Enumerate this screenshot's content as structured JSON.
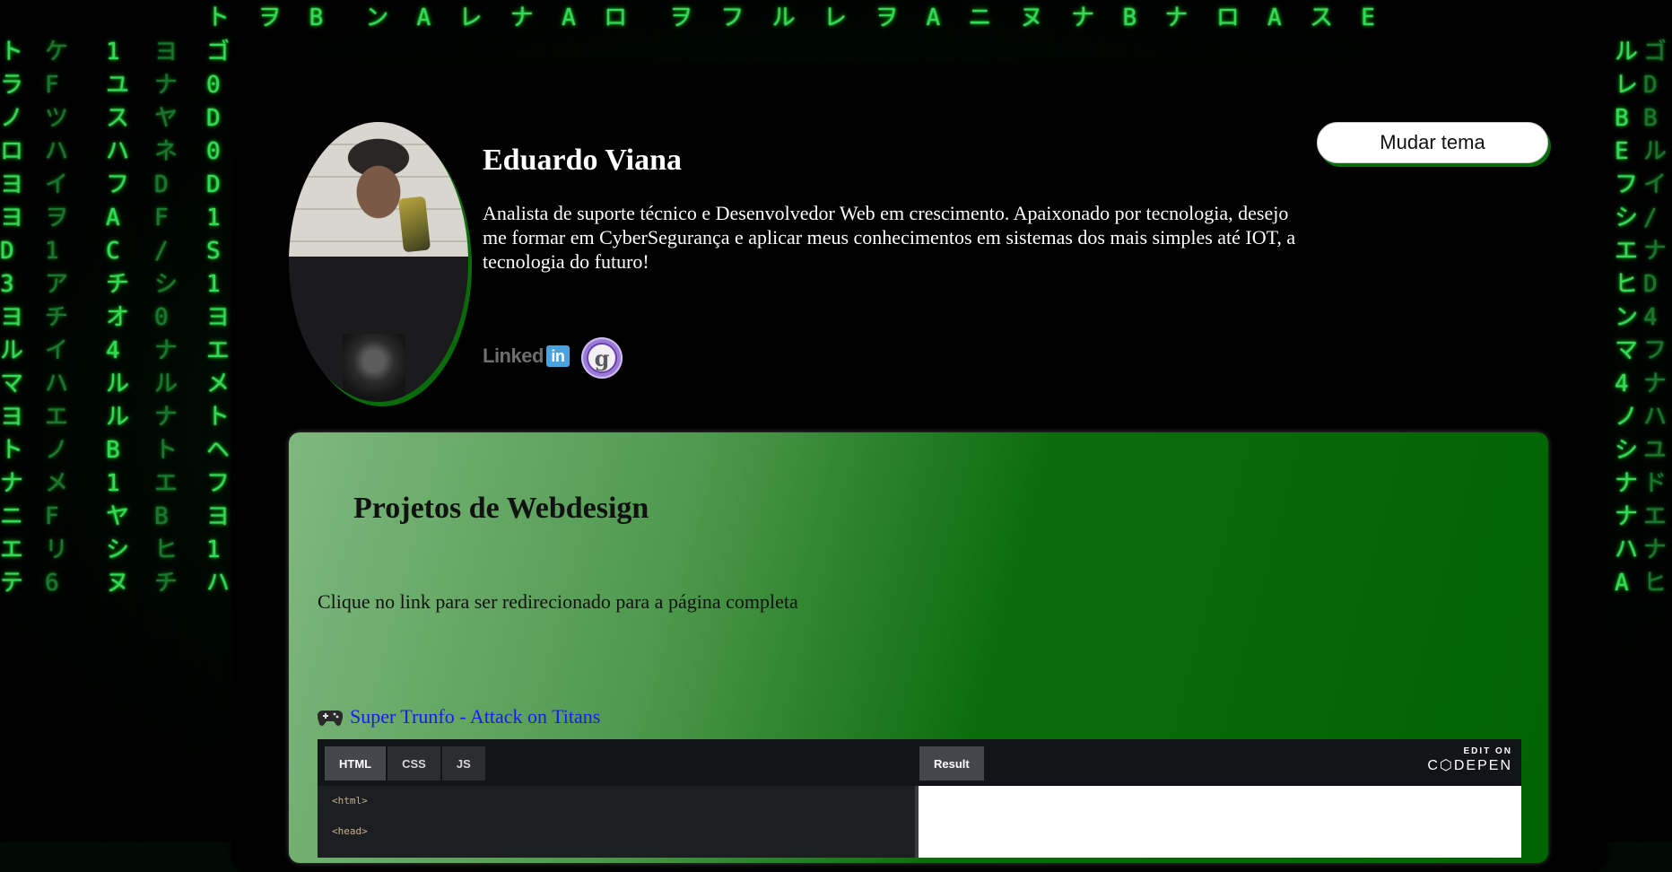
{
  "background": {
    "columns": [
      "ト\nラ\nノ\nロ\nヨ\nヨ\nD\n3\nヨ\nル\nマ\nヨ\nト\nナ\nニ\nエ\nテ",
      "ケ\nF\nツ\nハ\nイ\nヲ\n1\nア\nチ\nイ\nハ\nエ\nノ\nメ\nF\nリ\n6",
      "1\nユ\nス\nハ\nフ\nA\nC\nチ\nオ\n4\nル\nル\nB\n1\nヤ\nシ\nヌ",
      "ヨ\nナ\nヤ\nネ\nD\nF\n/\nシ\n0\nナ\nル\nナ\nト\nエ\nB\nヒ\nチ",
      "ゴ\n0\nD\n0\nD\n1\nS\n1\nヨ\nエ\nメ\nト\nヘ\nフ\nヨ\n1\nハ",
      "ル\nレ\nB\nE\nフ\nシ\nエ\nヒ\nン\nマ\n4\nノ\nシ\nナ\nナ\nハ\nA",
      "ゴ\nD\nB\nル\nイ\n/\nナ\nD\n4\nフ\nナ\nハ\nユ\nド\nエ\nナ\nヒ"
    ],
    "top_row": "ト  ヲ  B   ン  A  レ  ナ  A  ロ   ヲ  フ  ル  レ  ヲ  A  ニ  ヌ  ナ  B  ナ  ロ  A  ス  E"
  },
  "profile": {
    "name": "Eduardo Viana",
    "bio": "Analista de suporte técnico e Desenvolvedor Web em crescimento. Apaixonado por tecnologia, desejo me formar em CyberSegurança e aplicar meus conhecimentos em sistemas dos mais simples até IOT, a tecnologia do futuro!",
    "theme_button": "Mudar tema",
    "linkedin_text": "Linked",
    "linkedin_box": "in",
    "github_letter": "g"
  },
  "projects": {
    "title": "Projetos de Webdesign",
    "subtitle": "Clique no link para ser redirecionado para a página completa",
    "link_label": "Super Trunfo - Attack on Titans"
  },
  "embed": {
    "tabs": [
      "HTML",
      "CSS",
      "JS"
    ],
    "result_tab": "Result",
    "edit_on": "EDIT ON",
    "codepen_logo": "C⬡DEPEN",
    "code_lines": [
      "<html>",
      "<head>"
    ]
  },
  "colors": {
    "accent_green": "#006400",
    "card_bg": "#000000",
    "link_blue": "#1a1aee"
  }
}
